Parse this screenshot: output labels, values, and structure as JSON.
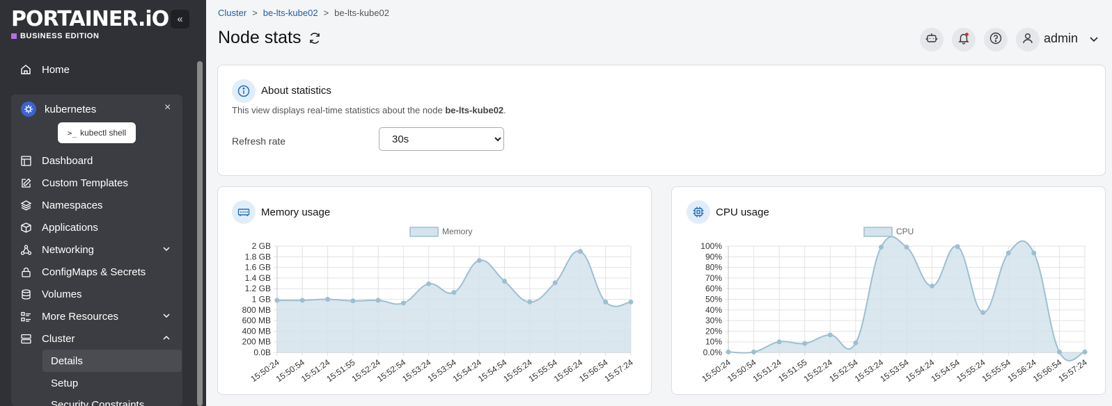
{
  "brand": {
    "name": "PORTAINER.iO",
    "edition": "BUSINESS EDITION"
  },
  "sidebar": {
    "home": "Home",
    "environment": {
      "name": "kubernetes",
      "close": "×",
      "kubectl": "kubectl shell"
    },
    "items": [
      {
        "label": "Dashboard",
        "icon": "dashboard-icon"
      },
      {
        "label": "Custom Templates",
        "icon": "edit-icon"
      },
      {
        "label": "Namespaces",
        "icon": "layers-icon"
      },
      {
        "label": "Applications",
        "icon": "box-icon"
      },
      {
        "label": "Networking",
        "icon": "network-icon",
        "expandable": true
      },
      {
        "label": "ConfigMaps & Secrets",
        "icon": "lock-icon"
      },
      {
        "label": "Volumes",
        "icon": "database-icon"
      },
      {
        "label": "More Resources",
        "icon": "list-icon",
        "expandable": true
      },
      {
        "label": "Cluster",
        "icon": "server-icon",
        "expanded": true
      }
    ],
    "cluster_sub": [
      {
        "label": "Details",
        "active": true
      },
      {
        "label": "Setup"
      },
      {
        "label": "Security Constraints"
      }
    ]
  },
  "breadcrumb": {
    "items": [
      "Cluster",
      "be-lts-kube02",
      "be-lts-kube02"
    ],
    "separator": ">"
  },
  "page": {
    "title": "Node stats"
  },
  "user": {
    "name": "admin"
  },
  "about": {
    "title": "About statistics",
    "text_prefix": "This view displays real-time statistics about the node ",
    "node": "be-lts-kube02",
    "text_suffix": ".",
    "refresh_label": "Refresh rate",
    "refresh_value": "30s"
  },
  "memory_card": {
    "title": "Memory usage"
  },
  "cpu_card": {
    "title": "CPU usage"
  },
  "colors": {
    "accent": "#1f5fa8",
    "series_line": "#9dbfd0",
    "series_fill": "#d4e3ec",
    "sidebar": "#2f3136"
  },
  "chart_data": [
    {
      "type": "area",
      "title": "",
      "legend": [
        "Memory"
      ],
      "legend_position": "top",
      "x": [
        "15:50:24",
        "15:50:54",
        "15:51:24",
        "15:51:55",
        "15:52:24",
        "15:52:54",
        "15:53:24",
        "15:53:54",
        "15:54:24",
        "15:54:54",
        "15:55:24",
        "15:55:54",
        "15:56:24",
        "15:56:54",
        "15:57:24"
      ],
      "series": [
        {
          "name": "Memory",
          "values": [
            0.98,
            0.98,
            1.0,
            0.97,
            0.98,
            0.93,
            1.29,
            1.13,
            1.73,
            1.34,
            0.95,
            1.31,
            1.9,
            0.95,
            0.95
          ]
        }
      ],
      "y_unit": "GB",
      "ylim": [
        0,
        2
      ],
      "yticks": [
        "0.0B",
        "200 MB",
        "400 MB",
        "600 MB",
        "800 MB",
        "1 GB",
        "1.2 GB",
        "1.4 GB",
        "1.6 GB",
        "1.8 GB",
        "2 GB"
      ],
      "grid": true
    },
    {
      "type": "area",
      "title": "",
      "legend": [
        "CPU"
      ],
      "legend_position": "top",
      "x": [
        "15:50:24",
        "15:50:54",
        "15:51:24",
        "15:51:55",
        "15:52:24",
        "15:52:54",
        "15:53:24",
        "15:53:54",
        "15:54:24",
        "15:54:54",
        "15:55:24",
        "15:55:54",
        "15:56:24",
        "15:56:54",
        "15:57:24"
      ],
      "series": [
        {
          "name": "CPU",
          "values": [
            0.5,
            0.5,
            10,
            8.5,
            16.5,
            9,
            99,
            99,
            62.5,
            99.5,
            37.5,
            93.5,
            93.5,
            0.5,
            0.5
          ]
        }
      ],
      "y_unit": "%",
      "ylim": [
        0,
        100
      ],
      "yticks": [
        "0.0%",
        "10%",
        "20%",
        "30%",
        "40%",
        "50%",
        "60%",
        "70%",
        "80%",
        "90%",
        "100%"
      ],
      "grid": true
    }
  ]
}
